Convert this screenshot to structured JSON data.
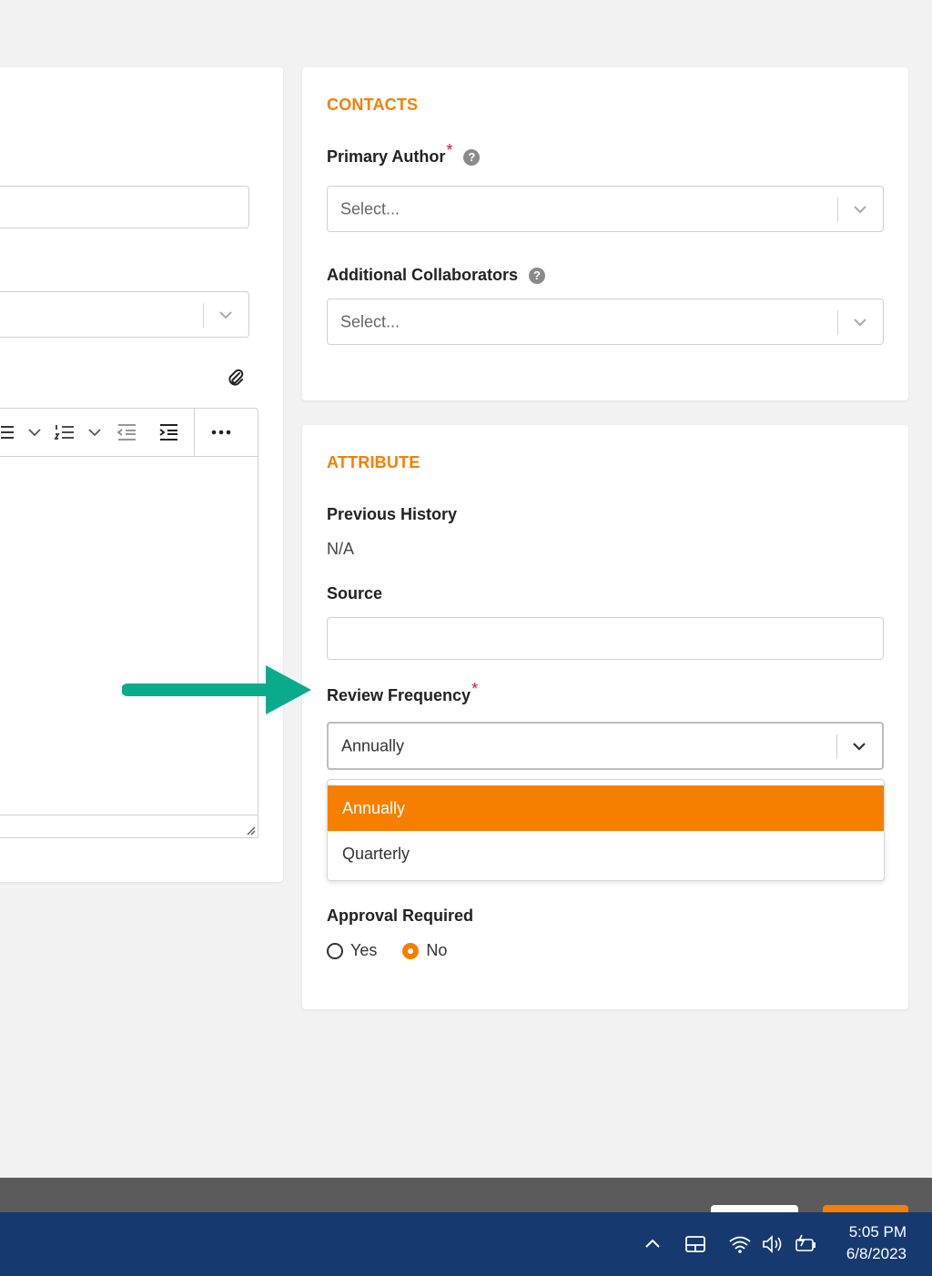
{
  "colors": {
    "accent": "#f77f00",
    "required": "#d3182e",
    "arrow": "#0aab8c",
    "taskbar": "#163a70"
  },
  "contacts": {
    "title": "CONTACTS",
    "primary_author": {
      "label": "Primary Author",
      "placeholder": "Select..."
    },
    "additional_collaborators": {
      "label": "Additional Collaborators",
      "placeholder": "Select..."
    }
  },
  "attribute": {
    "title": "ATTRIBUTE",
    "previous_history": {
      "label": "Previous History",
      "value": "N/A"
    },
    "source": {
      "label": "Source",
      "value": ""
    },
    "review_frequency": {
      "label": "Review Frequency",
      "selected": "Annually",
      "options": [
        "Annually",
        "Quarterly"
      ]
    },
    "approval_required": {
      "label": "Approval Required",
      "options": [
        "Yes",
        "No"
      ],
      "selected": "No"
    }
  },
  "editor_toolbar": {
    "icons": [
      "bullet-list-icon",
      "numbered-list-icon",
      "outdent-icon",
      "indent-icon",
      "more-options-icon"
    ]
  },
  "taskbar": {
    "time": "5:05 PM",
    "date": "6/8/2023",
    "icons": [
      "chevron-up-icon",
      "tablet-mode-icon",
      "wifi-icon",
      "volume-icon",
      "battery-icon"
    ]
  }
}
